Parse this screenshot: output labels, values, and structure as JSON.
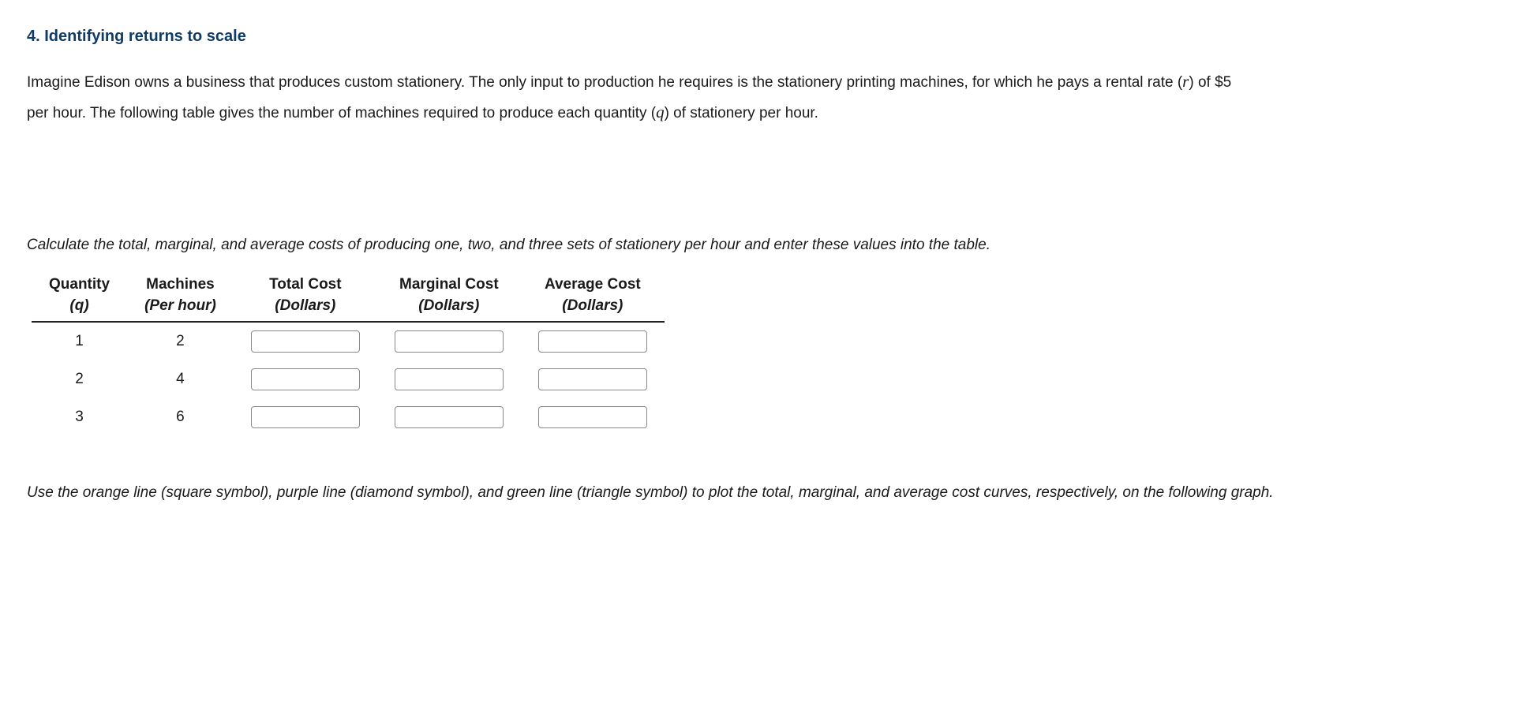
{
  "heading": "4. Identifying returns to scale",
  "paragraph": {
    "p1a": "Imagine Edison owns a business that produces custom stationery. The only input to production he requires is the stationery printing machines, for which he pays a rental rate (",
    "p1_r": "r",
    "p1b": ") of $5 per hour. The following table gives the number of machines required to produce each quantity (",
    "p1_q": "q",
    "p1c": ") of stationery per hour."
  },
  "instruction1": "Calculate the total, marginal, and average costs of producing one, two, and three sets of stationery per hour and enter these values into the table.",
  "table": {
    "headers": {
      "quantity": {
        "top": "Quantity",
        "sub": "(q)"
      },
      "machines": {
        "top": "Machines",
        "sub": "(Per hour)"
      },
      "total_cost": {
        "top": "Total Cost",
        "sub": "(Dollars)"
      },
      "marginal_cost": {
        "top": "Marginal Cost",
        "sub": "(Dollars)"
      },
      "average_cost": {
        "top": "Average Cost",
        "sub": "(Dollars)"
      }
    },
    "rows": [
      {
        "q": "1",
        "machines": "2",
        "tc": "",
        "mc": "",
        "ac": ""
      },
      {
        "q": "2",
        "machines": "4",
        "tc": "",
        "mc": "",
        "ac": ""
      },
      {
        "q": "3",
        "machines": "6",
        "tc": "",
        "mc": "",
        "ac": ""
      }
    ]
  },
  "instruction2": "Use the orange line (square symbol), purple line (diamond symbol), and green line (triangle symbol) to plot the total, marginal, and average cost curves, respectively, on the following graph."
}
